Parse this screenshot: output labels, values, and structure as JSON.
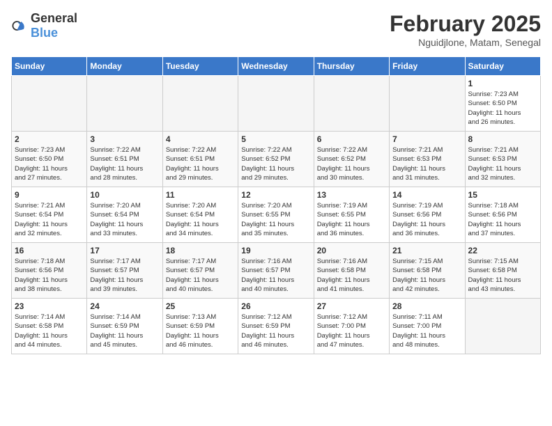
{
  "header": {
    "logo_general": "General",
    "logo_blue": "Blue",
    "title": "February 2025",
    "subtitle": "Nguidjlone, Matam, Senegal"
  },
  "weekdays": [
    "Sunday",
    "Monday",
    "Tuesday",
    "Wednesday",
    "Thursday",
    "Friday",
    "Saturday"
  ],
  "weeks": [
    [
      {
        "day": "",
        "info": ""
      },
      {
        "day": "",
        "info": ""
      },
      {
        "day": "",
        "info": ""
      },
      {
        "day": "",
        "info": ""
      },
      {
        "day": "",
        "info": ""
      },
      {
        "day": "",
        "info": ""
      },
      {
        "day": "1",
        "info": "Sunrise: 7:23 AM\nSunset: 6:50 PM\nDaylight: 11 hours\nand 26 minutes."
      }
    ],
    [
      {
        "day": "2",
        "info": "Sunrise: 7:23 AM\nSunset: 6:50 PM\nDaylight: 11 hours\nand 27 minutes."
      },
      {
        "day": "3",
        "info": "Sunrise: 7:22 AM\nSunset: 6:51 PM\nDaylight: 11 hours\nand 28 minutes."
      },
      {
        "day": "4",
        "info": "Sunrise: 7:22 AM\nSunset: 6:51 PM\nDaylight: 11 hours\nand 29 minutes."
      },
      {
        "day": "5",
        "info": "Sunrise: 7:22 AM\nSunset: 6:52 PM\nDaylight: 11 hours\nand 29 minutes."
      },
      {
        "day": "6",
        "info": "Sunrise: 7:22 AM\nSunset: 6:52 PM\nDaylight: 11 hours\nand 30 minutes."
      },
      {
        "day": "7",
        "info": "Sunrise: 7:21 AM\nSunset: 6:53 PM\nDaylight: 11 hours\nand 31 minutes."
      },
      {
        "day": "8",
        "info": "Sunrise: 7:21 AM\nSunset: 6:53 PM\nDaylight: 11 hours\nand 32 minutes."
      }
    ],
    [
      {
        "day": "9",
        "info": "Sunrise: 7:21 AM\nSunset: 6:54 PM\nDaylight: 11 hours\nand 32 minutes."
      },
      {
        "day": "10",
        "info": "Sunrise: 7:20 AM\nSunset: 6:54 PM\nDaylight: 11 hours\nand 33 minutes."
      },
      {
        "day": "11",
        "info": "Sunrise: 7:20 AM\nSunset: 6:54 PM\nDaylight: 11 hours\nand 34 minutes."
      },
      {
        "day": "12",
        "info": "Sunrise: 7:20 AM\nSunset: 6:55 PM\nDaylight: 11 hours\nand 35 minutes."
      },
      {
        "day": "13",
        "info": "Sunrise: 7:19 AM\nSunset: 6:55 PM\nDaylight: 11 hours\nand 36 minutes."
      },
      {
        "day": "14",
        "info": "Sunrise: 7:19 AM\nSunset: 6:56 PM\nDaylight: 11 hours\nand 36 minutes."
      },
      {
        "day": "15",
        "info": "Sunrise: 7:18 AM\nSunset: 6:56 PM\nDaylight: 11 hours\nand 37 minutes."
      }
    ],
    [
      {
        "day": "16",
        "info": "Sunrise: 7:18 AM\nSunset: 6:56 PM\nDaylight: 11 hours\nand 38 minutes."
      },
      {
        "day": "17",
        "info": "Sunrise: 7:17 AM\nSunset: 6:57 PM\nDaylight: 11 hours\nand 39 minutes."
      },
      {
        "day": "18",
        "info": "Sunrise: 7:17 AM\nSunset: 6:57 PM\nDaylight: 11 hours\nand 40 minutes."
      },
      {
        "day": "19",
        "info": "Sunrise: 7:16 AM\nSunset: 6:57 PM\nDaylight: 11 hours\nand 40 minutes."
      },
      {
        "day": "20",
        "info": "Sunrise: 7:16 AM\nSunset: 6:58 PM\nDaylight: 11 hours\nand 41 minutes."
      },
      {
        "day": "21",
        "info": "Sunrise: 7:15 AM\nSunset: 6:58 PM\nDaylight: 11 hours\nand 42 minutes."
      },
      {
        "day": "22",
        "info": "Sunrise: 7:15 AM\nSunset: 6:58 PM\nDaylight: 11 hours\nand 43 minutes."
      }
    ],
    [
      {
        "day": "23",
        "info": "Sunrise: 7:14 AM\nSunset: 6:58 PM\nDaylight: 11 hours\nand 44 minutes."
      },
      {
        "day": "24",
        "info": "Sunrise: 7:14 AM\nSunset: 6:59 PM\nDaylight: 11 hours\nand 45 minutes."
      },
      {
        "day": "25",
        "info": "Sunrise: 7:13 AM\nSunset: 6:59 PM\nDaylight: 11 hours\nand 46 minutes."
      },
      {
        "day": "26",
        "info": "Sunrise: 7:12 AM\nSunset: 6:59 PM\nDaylight: 11 hours\nand 46 minutes."
      },
      {
        "day": "27",
        "info": "Sunrise: 7:12 AM\nSunset: 7:00 PM\nDaylight: 11 hours\nand 47 minutes."
      },
      {
        "day": "28",
        "info": "Sunrise: 7:11 AM\nSunset: 7:00 PM\nDaylight: 11 hours\nand 48 minutes."
      },
      {
        "day": "",
        "info": ""
      }
    ]
  ]
}
